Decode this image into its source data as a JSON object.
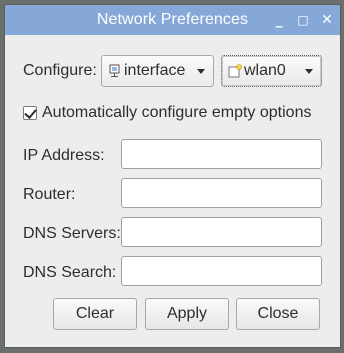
{
  "window": {
    "title": "Network Preferences",
    "controls": {
      "minimize": "_",
      "maximize": "□",
      "close": "✕"
    }
  },
  "configure": {
    "label": "Configure:",
    "type_value": "interface",
    "type_icon": "network-interface-icon",
    "device_value": "wlan0",
    "device_icon": "wireless-icon"
  },
  "auto_option": {
    "label": "Automatically configure empty options",
    "checked": true
  },
  "fields": [
    {
      "label": "IP Address:",
      "value": ""
    },
    {
      "label": "Router:",
      "value": ""
    },
    {
      "label": "DNS Servers:",
      "value": ""
    },
    {
      "label": "DNS Search:",
      "value": ""
    }
  ],
  "buttons": {
    "clear": "Clear",
    "apply": "Apply",
    "close": "Close"
  },
  "colors": {
    "titlebar": "#86a8d8",
    "window_bg": "#ededed",
    "desktop_bg": "#6b6f6c"
  }
}
